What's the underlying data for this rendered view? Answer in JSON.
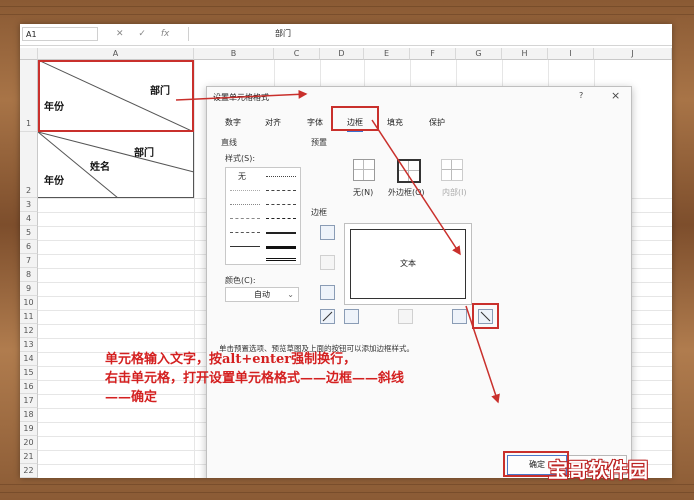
{
  "formula_bar": {
    "cell_ref": "A1",
    "icons": [
      "close-icon",
      "check-icon",
      "function-icon"
    ],
    "fx_symbol": "fx",
    "value": "部门"
  },
  "columns": [
    "A",
    "B",
    "C",
    "D",
    "E",
    "F",
    "G",
    "H",
    "I",
    "J"
  ],
  "rows": [
    "1",
    "2",
    "3",
    "4",
    "5",
    "6",
    "7",
    "8",
    "9",
    "10",
    "11",
    "12",
    "13",
    "14",
    "15",
    "16",
    "17",
    "18",
    "19",
    "20",
    "21",
    "22"
  ],
  "cells": {
    "a1_dept": "部门",
    "a1_year": "年份",
    "a_merged_dept": "部门",
    "a_merged_name": "姓名",
    "a_merged_year": "年份"
  },
  "dialog": {
    "title": "设置单元格格式",
    "help": "?",
    "close": "×",
    "tabs": [
      "数字",
      "对齐",
      "字体",
      "边框",
      "填充",
      "保护"
    ],
    "active_tab": "边框",
    "line_section": "直线",
    "style_label": "样式(S):",
    "style_none": "无",
    "color_label": "颜色(C):",
    "color_value": "自动",
    "presets_label": "预置",
    "presets": [
      "无(N)",
      "外边框(O)",
      "内部(I)"
    ],
    "border_label": "边框",
    "preview_text": "文本",
    "hint": "单击预置选项、预览草图及上面的按钮可以添加边框样式。",
    "ok": "确定",
    "cancel": "取消"
  },
  "annotation": {
    "lines": [
      "单元格输入文字，按alt+enter强制换行，",
      "右击单元格，打开设置单元格格式——边框——斜线",
      "——确定"
    ],
    "color": "#d42020"
  },
  "watermark": "宝哥软件园",
  "colors": {
    "highlight": "#c9302c",
    "accent": "#3b6fd0"
  }
}
